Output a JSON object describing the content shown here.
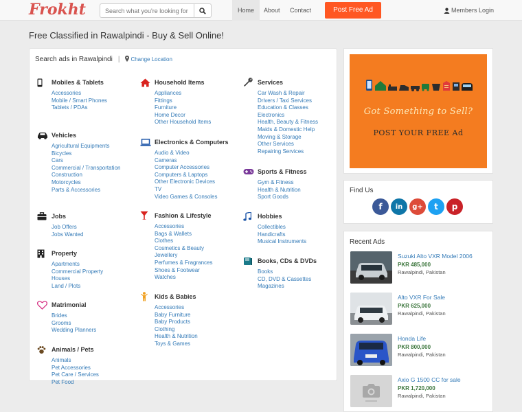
{
  "brand": {
    "logo": "Frokht"
  },
  "nav": {
    "search_placeholder": "Search what you're looking for",
    "links": [
      "Home",
      "About",
      "Contact"
    ],
    "post_ad": "Post Free Ad",
    "members": "Members Login"
  },
  "page": {
    "title": "Free Classified in Rawalpindi - Buy & Sell Online!",
    "search_in": "Search ads in Rawalpindi",
    "separator": "|",
    "change_location": "Change Location"
  },
  "categories": [
    {
      "name": "Mobiles & Tablets",
      "icon": "mobile-icon",
      "items": [
        "Accessories",
        "Mobile / Smart Phones",
        "Tablets / PDAs"
      ]
    },
    {
      "name": "Vehicles",
      "icon": "car-icon",
      "items": [
        "Agricultural Equipments",
        "Bicycles",
        "Cars",
        "Commercial / Transportation",
        "Construction",
        "Motorcycles",
        "Parts & Accessories"
      ]
    },
    {
      "name": "Jobs",
      "icon": "briefcase-icon",
      "items": [
        "Job Offers",
        "Jobs Wanted"
      ]
    },
    {
      "name": "Property",
      "icon": "building-icon",
      "items": [
        "Apartments",
        "Commercial Property",
        "Houses",
        "Land / Plots"
      ]
    },
    {
      "name": "Matrimonial",
      "icon": "heart-icon",
      "items": [
        "Brides",
        "Grooms",
        "Wedding Planners"
      ]
    },
    {
      "name": "Animals / Pets",
      "icon": "paw-icon",
      "items": [
        "Animals",
        "Pet Accessories",
        "Pet Care / Services",
        "Pet Food"
      ]
    },
    {
      "name": "Household Items",
      "icon": "home-icon",
      "items": [
        "Appliances",
        "Fittings",
        "Furniture",
        "Home Decor",
        "Other Household Items"
      ]
    },
    {
      "name": "Electronics & Computers",
      "icon": "laptop-icon",
      "items": [
        "Audio & Video",
        "Cameras",
        "Computer Accessories",
        "Computers & Laptops",
        "Other Electronic Devices",
        "TV",
        "Video Games & Consoles"
      ]
    },
    {
      "name": "Fashion & Lifestyle",
      "icon": "glass-icon",
      "items": [
        "Accessories",
        "Bags & Wallets",
        "Clothes",
        "Cosmetics & Beauty",
        "Jewellery",
        "Perfumes & Fragrances",
        "Shoes & Footwear",
        "Watches"
      ]
    },
    {
      "name": "Kids & Babies",
      "icon": "child-icon",
      "items": [
        "Accessories",
        "Baby Furniture",
        "Baby Products",
        "Clothing",
        "Health & Nutrition",
        "Toys & Games"
      ]
    },
    {
      "name": "Services",
      "icon": "wrench-icon",
      "items": [
        "Car Wash & Repair",
        "Drivers / Taxi Services",
        "Education & Classes",
        "Electronics",
        "Health, Beauty & Fitness",
        "Maids & Domestic Help",
        "Moving & Storage",
        "Other Services",
        "Repairing Services"
      ]
    },
    {
      "name": "Sports & Fitness",
      "icon": "gamepad-icon",
      "items": [
        "Gym & Fitness",
        "Health & Nutrition",
        "Sport Goods"
      ]
    },
    {
      "name": "Hobbies",
      "icon": "music-icon",
      "items": [
        "Collectibles",
        "Handicrafts",
        "Musical Instruments"
      ]
    },
    {
      "name": "Books, CDs & DVDs",
      "icon": "book-icon",
      "items": [
        "Books",
        "CD, DVD & Cassettes",
        "Magazines"
      ]
    }
  ],
  "banner": {
    "line1": "Got Something to Sell?",
    "line2": "POST YOUR FREE Ad"
  },
  "find_us": {
    "title": "Find Us",
    "networks": [
      {
        "name": "facebook-icon",
        "glyph": "f",
        "color": "#3b5998"
      },
      {
        "name": "linkedin-icon",
        "glyph": "in",
        "color": "#0e76a8"
      },
      {
        "name": "google-plus-icon",
        "glyph": "g+",
        "color": "#dd4b39"
      },
      {
        "name": "twitter-icon",
        "glyph": "t",
        "color": "#1da1f2"
      },
      {
        "name": "pinterest-icon",
        "glyph": "p",
        "color": "#c92228"
      }
    ]
  },
  "recent": {
    "title": "Recent Ads",
    "items": [
      {
        "title": "Suzuki Alto VXR Model 2006",
        "price": "PKR 485,000",
        "location": "Rawalpindi, Pakistan",
        "thumb_color": "#3a4a55"
      },
      {
        "title": "Alto VXR For Sale",
        "price": "PKR 625,000",
        "location": "Rawalpindi, Pakistan",
        "thumb_color": "#c9ced4"
      },
      {
        "title": "Honda Life",
        "price": "PKR 800,000",
        "location": "Rawalpindi, Pakistan",
        "thumb_color": "#2a55c8"
      },
      {
        "title": "Axio G 1500 CC for sale",
        "price": "PKR 1,720,000",
        "location": "Rawalpindi, Pakistan",
        "thumb_color": "#d6d6d6"
      }
    ]
  }
}
